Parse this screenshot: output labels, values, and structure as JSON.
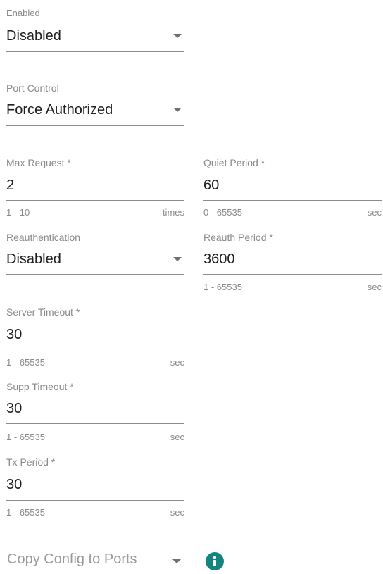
{
  "enabled": {
    "label": "Enabled",
    "value": "Disabled"
  },
  "port_control": {
    "label": "Port Control",
    "value": "Force Authorized"
  },
  "max_request": {
    "label": "Max Request *",
    "value": "2",
    "hint": "1 - 10",
    "unit": "times"
  },
  "quiet_period": {
    "label": "Quiet Period *",
    "value": "60",
    "hint": "0 - 65535",
    "unit": "sec"
  },
  "reauthentication": {
    "label": "Reauthentication",
    "value": "Disabled"
  },
  "reauth_period": {
    "label": "Reauth Period *",
    "value": "3600",
    "hint": "1 - 65535",
    "unit": "sec"
  },
  "server_timeout": {
    "label": "Server Timeout *",
    "value": "30",
    "hint": "1 - 65535",
    "unit": "sec"
  },
  "supp_timeout": {
    "label": "Supp Timeout *",
    "value": "30",
    "hint": "1 - 65535",
    "unit": "sec"
  },
  "tx_period": {
    "label": "Tx Period *",
    "value": "30",
    "hint": "1 - 65535",
    "unit": "sec"
  },
  "copy_config": {
    "label": "Copy Config to Ports",
    "info_icon": "info-icon",
    "info_color": "#12857f"
  }
}
